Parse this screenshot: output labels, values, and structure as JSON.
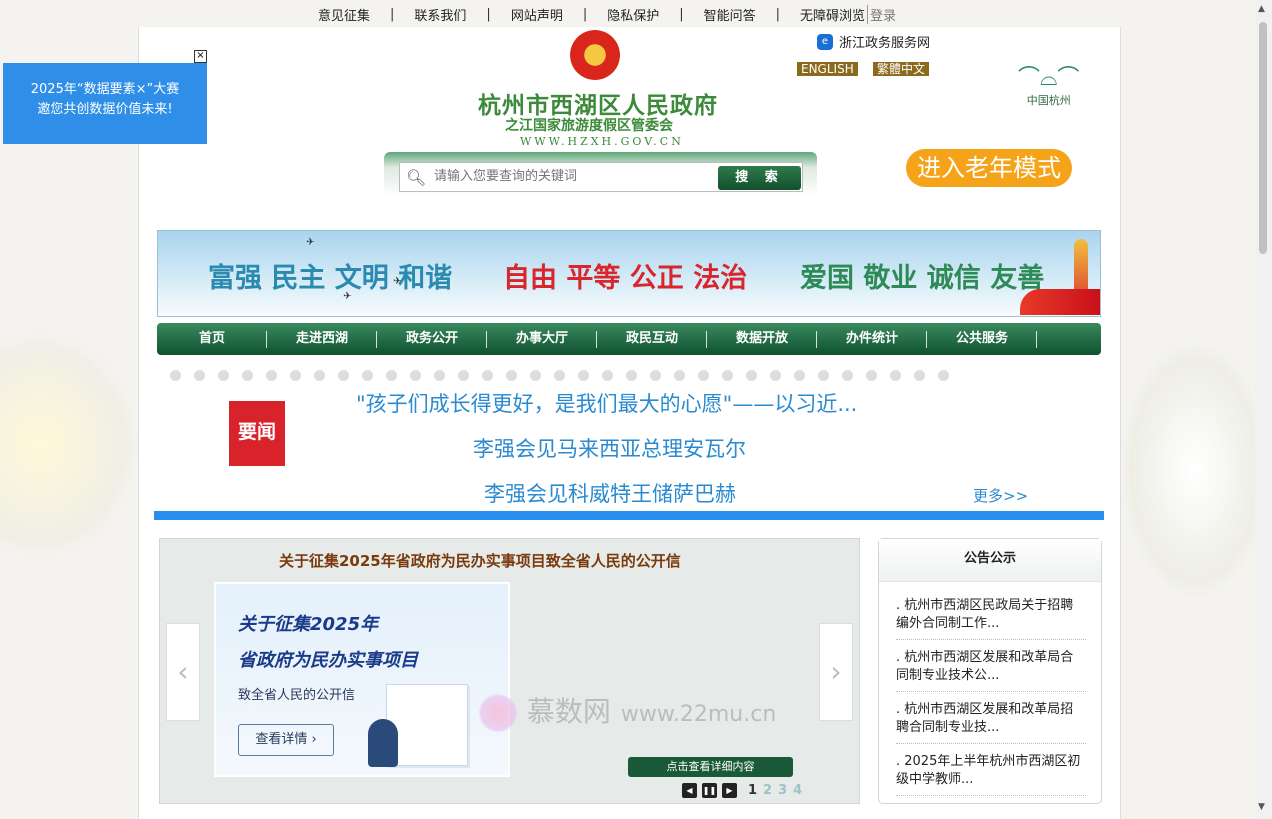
{
  "topbar": {
    "links": [
      "意见征集",
      "联系我们",
      "网站声明",
      "隐私保护",
      "智能问答",
      "无障碍浏览"
    ],
    "separator": "|",
    "login": "登录"
  },
  "ad": {
    "line1": "2025年“数据要素×”大赛",
    "line2": "邀您共创数据价值未来!",
    "close": "×"
  },
  "header": {
    "title": "杭州市西湖区人民政府",
    "subtitle": "之江国家旅游度假区管委会",
    "url": "WWW.HZXH.GOV.CN",
    "zj_link": "浙江政务服务网",
    "lang_en": "ENGLISH",
    "lang_tc": "繁體中文",
    "hz_logo_text": "中国杭州"
  },
  "search": {
    "placeholder": "请输入您要查询的关键词",
    "button": "搜 索"
  },
  "elder_mode": "进入老年模式",
  "banner": {
    "group1": "富强 民主 文明 和谐",
    "group2": "自由 平等 公正 法治",
    "group3": "爱国 敬业 诚信 友善"
  },
  "nav": [
    "首页",
    "走进西湖",
    "政务公开",
    "办事大厅",
    "政民互动",
    "数据开放",
    "办件统计",
    "公共服务"
  ],
  "news": {
    "tag": "要闻",
    "items": [
      "\"孩子们成长得更好，是我们最大的心愿\"——以习近...",
      "李强会见马来西亚总理安瓦尔",
      "李强会见科威特王储萨巴赫"
    ],
    "more": "更多>>"
  },
  "slider": {
    "title": "关于征集2025年省政府为民办实事项目致全省人民的公开信",
    "image_line1": "关于征集2025年",
    "image_line2": "省政府为民办实事项目",
    "image_line3": "致全省人民的公开信",
    "image_button": "查看详情",
    "detail_button": "点击查看详细内容",
    "pages": [
      "1",
      "2",
      "3",
      "4"
    ]
  },
  "watermark": {
    "name": "慕数网",
    "url": "www.22mu.cn"
  },
  "notice": {
    "title": "公告公示",
    "items": [
      ". 杭州市西湖区民政局关于招聘编外合同制工作...",
      ". 杭州市西湖区发展和改革局合同制专业技术公...",
      ". 杭州市西湖区发展和改革局招聘合同制专业技...",
      ". 2025年上半年杭州市西湖区初级中学教师..."
    ]
  },
  "colors": {
    "nav_green": "#0f5130",
    "title_green": "#3c8a3a",
    "news_blue": "#2a8ad0",
    "accent_red": "#d8232a",
    "elder_orange": "#f5a319"
  }
}
